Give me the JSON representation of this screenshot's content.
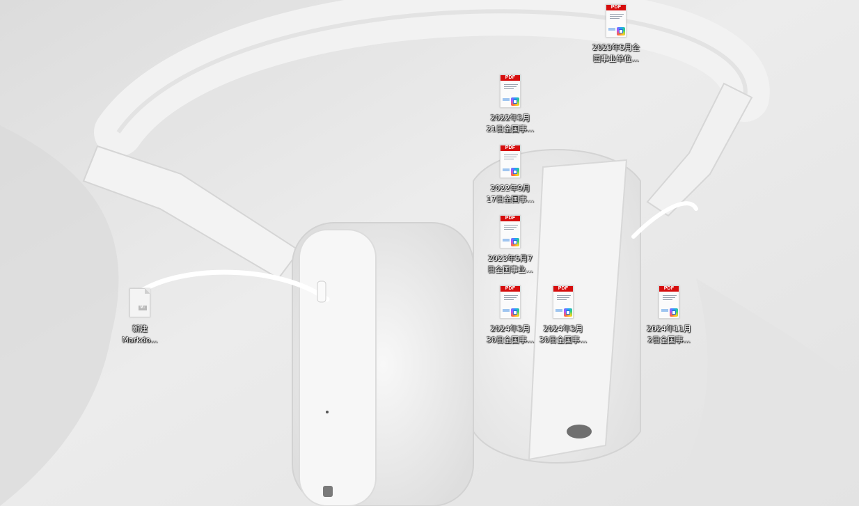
{
  "desktop": {
    "icons": [
      {
        "type": "pdf",
        "line1": "2023年5月全",
        "line2": "国事业单位..."
      },
      {
        "type": "pdf",
        "line1": "2022年5月",
        "line2": "21日全国事..."
      },
      {
        "type": "pdf",
        "line1": "2022年9月",
        "line2": "17日全国事..."
      },
      {
        "type": "pdf",
        "line1": "2023年5月7",
        "line2": "日全国事业..."
      },
      {
        "type": "pdf",
        "line1": "2024年3月",
        "line2": "30日全国事..."
      },
      {
        "type": "pdf",
        "line1": "2024年3月",
        "line2": "30日全国事..."
      },
      {
        "type": "pdf",
        "line1": "2024年11月",
        "line2": "2日全国事..."
      },
      {
        "type": "markdown",
        "line1": "新建",
        "line2": "Markdo..."
      }
    ],
    "pdf_tag": "PDF",
    "md_tag": "M↓"
  },
  "colors": {
    "pdf_tag": "#d60d0d",
    "wallpaper": "#e9e9e9",
    "label_text": "#ffffff"
  }
}
